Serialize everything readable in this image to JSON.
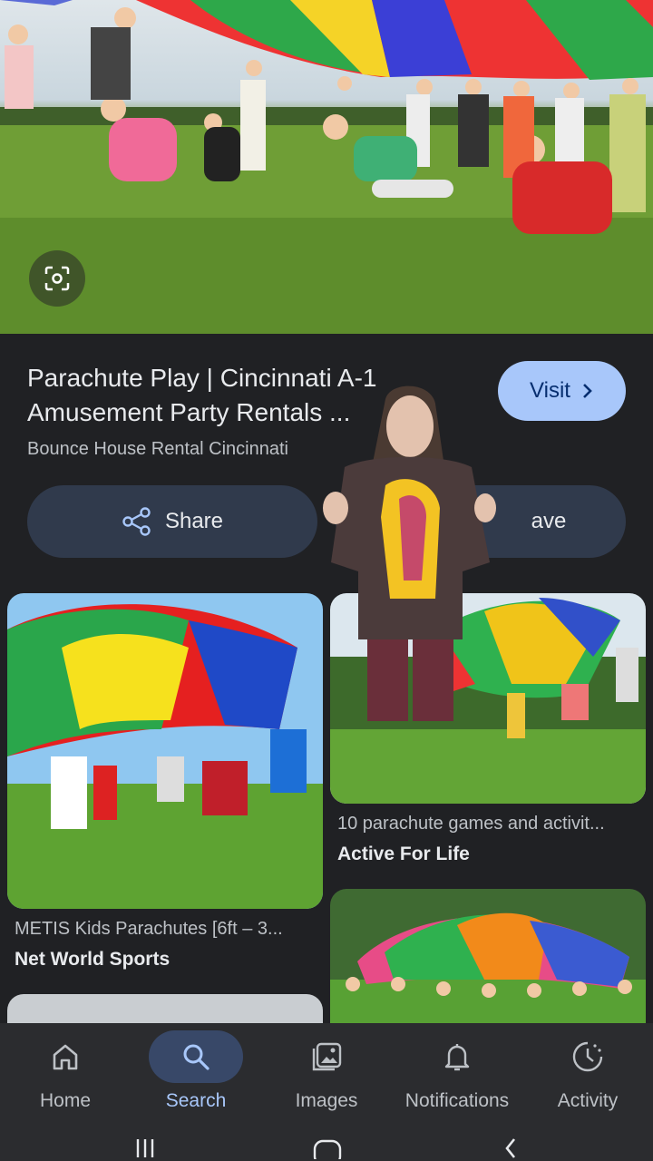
{
  "result": {
    "title": "Parachute Play | Cincinnati A-1\nAmusement Party Rentals ...",
    "source": "Bounce House Rental Cincinnati",
    "visit_label": "Visit",
    "share_label": "Share",
    "save_label": "ave"
  },
  "grid": [
    {
      "caption": "METIS Kids Parachutes [6ft – 3...",
      "site": "Net World Sports"
    },
    {
      "caption": "10 parachute games and activit...",
      "site": "Active For Life"
    }
  ],
  "nav": {
    "items": [
      {
        "label": "Home",
        "icon": "home-icon"
      },
      {
        "label": "Search",
        "icon": "search-icon"
      },
      {
        "label": "Images",
        "icon": "images-icon"
      },
      {
        "label": "Notifications",
        "icon": "bell-icon"
      },
      {
        "label": "Activity",
        "icon": "activity-icon"
      }
    ],
    "active": "Search"
  },
  "colors": {
    "accent": "#a8c7fa",
    "background": "#202124",
    "pill": "#303a4c"
  }
}
